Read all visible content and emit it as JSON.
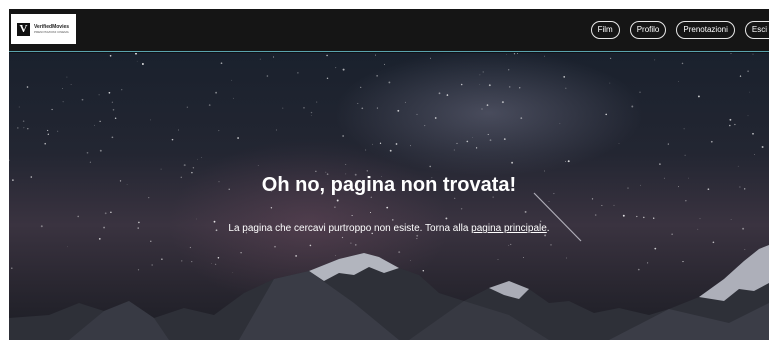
{
  "brand": {
    "logo_letter": "V",
    "name": "VerifiedMovies",
    "tagline": "PRENOTAZIONI CINEMA"
  },
  "nav": {
    "items": [
      {
        "label": "Film"
      },
      {
        "label": "Profilo"
      },
      {
        "label": "Prenotazioni"
      },
      {
        "label": "Esci"
      }
    ]
  },
  "error": {
    "title": "Oh no, pagina non trovata!",
    "message_prefix": "La pagina che cercavi purtroppo non esiste. Torna alla",
    "link_label": "pagina principale",
    "message_suffix": "."
  },
  "colors": {
    "navbar_bg": "#151515",
    "nav_border": "#5aa3ad",
    "text": "#ffffff"
  }
}
